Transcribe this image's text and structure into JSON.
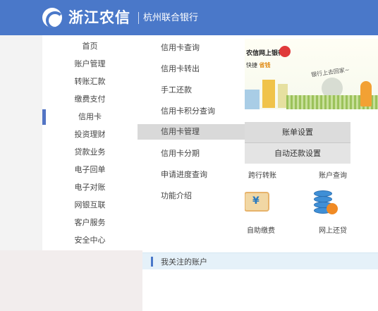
{
  "header": {
    "brand_name": "浙江农信",
    "brand_sub": "杭州联合银行"
  },
  "sidebar": {
    "items": [
      {
        "label": "首页"
      },
      {
        "label": "账户管理"
      },
      {
        "label": "转账汇款"
      },
      {
        "label": "缴费支付"
      },
      {
        "label": "信用卡"
      },
      {
        "label": "投资理财"
      },
      {
        "label": "贷款业务"
      },
      {
        "label": "电子回单"
      },
      {
        "label": "电子对账"
      },
      {
        "label": "网银互联"
      },
      {
        "label": "客户服务"
      },
      {
        "label": "安全中心"
      }
    ],
    "active_index": 4
  },
  "credit_menu": {
    "items": [
      {
        "label": "信用卡查询"
      },
      {
        "label": "信用卡转出"
      },
      {
        "label": "手工还款"
      },
      {
        "label": "信用卡积分查询"
      },
      {
        "label": "信用卡管理"
      },
      {
        "label": "信用卡分期"
      },
      {
        "label": "申请进度查询"
      },
      {
        "label": "功能介绍"
      }
    ],
    "hover_index": 4
  },
  "submenu": {
    "items": [
      {
        "label": "账单设置"
      },
      {
        "label": "自动还款设置"
      }
    ]
  },
  "banner": {
    "line1": "农信网上银行",
    "line2_a": "快捷",
    "line2_b": "省钱",
    "slogan": "银行上去回家~"
  },
  "quick": {
    "row1": [
      {
        "label": "跨行转账"
      },
      {
        "label": "账户查询"
      }
    ],
    "row2": [
      {
        "label": "自助缴费"
      },
      {
        "label": "网上还贷"
      }
    ]
  },
  "account_section": {
    "title": "我关注的账户"
  },
  "colors": {
    "header_bg": "#4a78c9",
    "active_marker": "#5274c4",
    "hover_bg": "#d9d9d9"
  }
}
